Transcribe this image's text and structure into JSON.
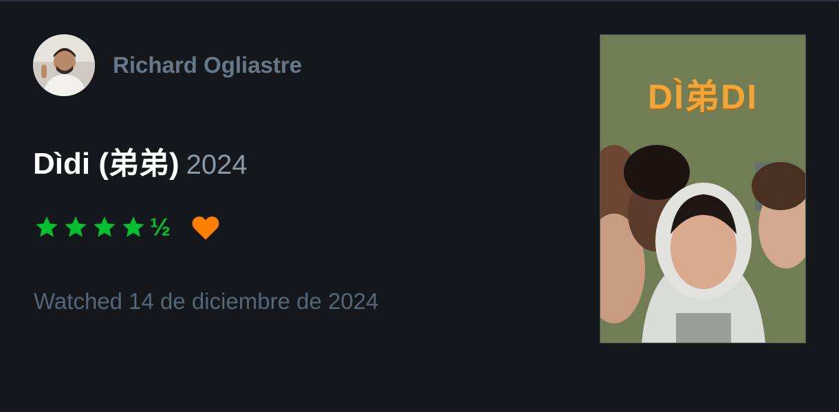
{
  "user": {
    "name": "Richard Ogliastre"
  },
  "film": {
    "title": "Dìdi (弟弟)",
    "year": "2024"
  },
  "rating": {
    "stars": 4.5,
    "half_glyph": "½",
    "liked": true
  },
  "watched": {
    "text": "Watched 14 de diciembre de 2024"
  },
  "poster": {
    "title_text": "DÌ弟DI"
  },
  "colors": {
    "background": "#14181c",
    "star": "#00c030",
    "heart": "#ff8000",
    "username": "#667788",
    "muted": "#556677"
  }
}
